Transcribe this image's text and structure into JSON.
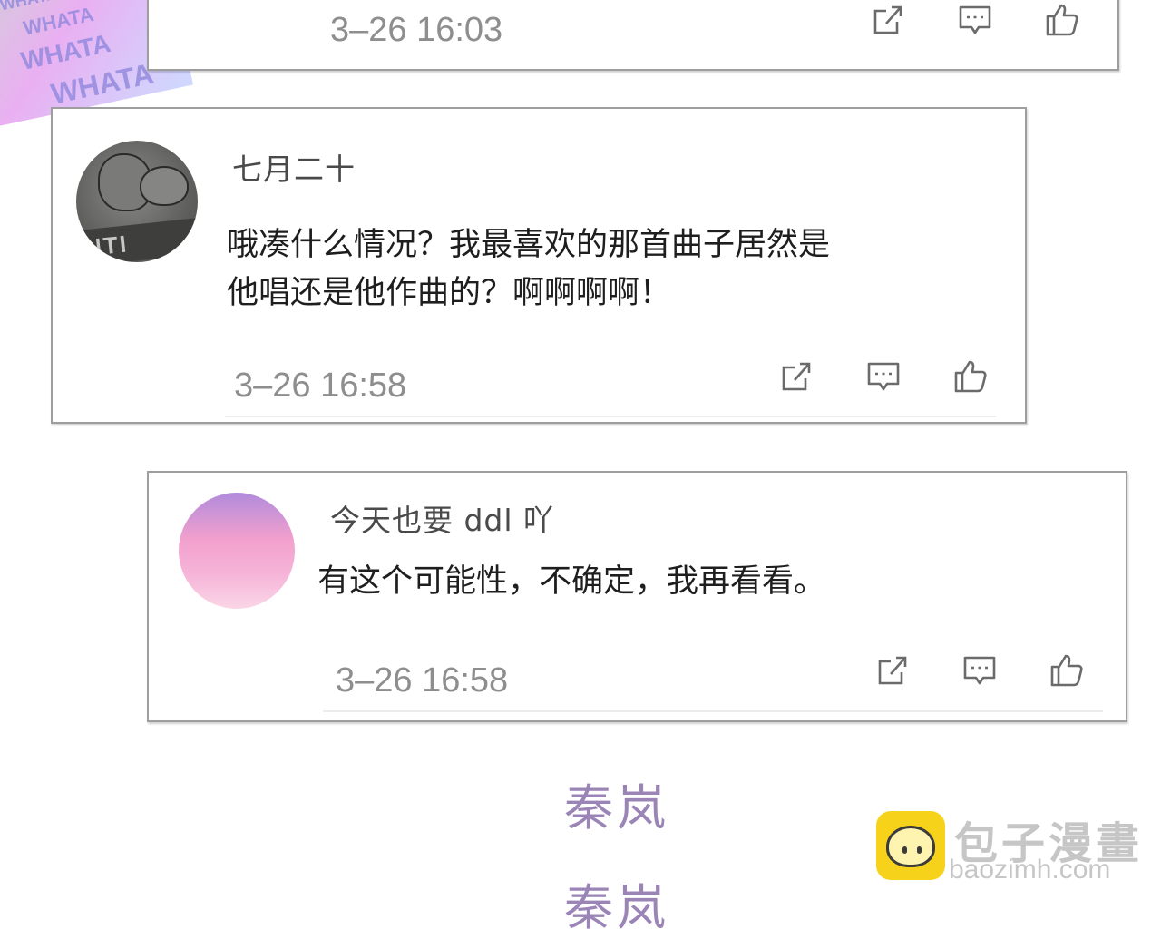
{
  "comments": [
    {
      "time": "3–26 16:03"
    },
    {
      "username": "七月二十",
      "content_line1": "哦凑什么情况？我最喜欢的那首曲子居然是",
      "content_line2": "他唱还是他作曲的？啊啊啊啊！",
      "time": "3–26 16:58",
      "avatar_text": "NTI"
    },
    {
      "username": "今天也要 ddl 吖",
      "content_line1": "有这个可能性，不确定，我再看看。",
      "time": "3–26 16:58"
    }
  ],
  "actions": [
    "share-icon",
    "comment-icon",
    "like-icon"
  ],
  "decor": {
    "sticker_text": "WHATA"
  },
  "signature": {
    "line1": "秦岚",
    "line2": "秦岚"
  },
  "watermark": {
    "brand_cn": "包子漫畫",
    "brand_en": "baozimh.com"
  },
  "colors": {
    "card_border": "#9e9e9e",
    "timestamp": "#8e8e8e",
    "signature": "#9b84b6",
    "logo_yellow": "#f6d21a"
  }
}
